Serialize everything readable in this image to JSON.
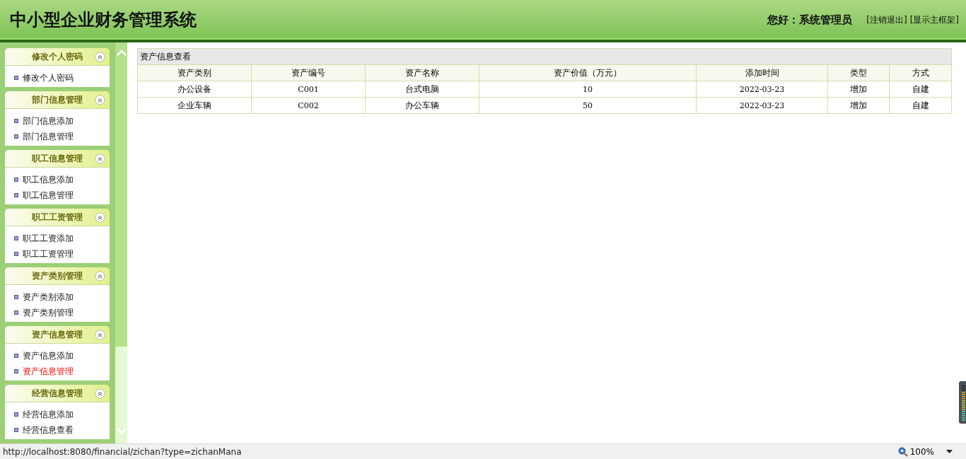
{
  "header": {
    "title": "中小型企业财务管理系统",
    "greeting": "您好：系统管理员",
    "links": [
      "[注销退出]",
      "[显示主框架]"
    ]
  },
  "sidebar": {
    "panels": [
      {
        "title": "修改个人密码",
        "items": [
          {
            "label": "修改个人密码",
            "selected": false
          }
        ]
      },
      {
        "title": "部门信息管理",
        "items": [
          {
            "label": "部门信息添加",
            "selected": false
          },
          {
            "label": "部门信息管理",
            "selected": false
          }
        ]
      },
      {
        "title": "职工信息管理",
        "items": [
          {
            "label": "职工信息添加",
            "selected": false
          },
          {
            "label": "职工信息管理",
            "selected": false
          }
        ]
      },
      {
        "title": "职工工资管理",
        "items": [
          {
            "label": "职工工资添加",
            "selected": false
          },
          {
            "label": "职工工资管理",
            "selected": false
          }
        ]
      },
      {
        "title": "资产类别管理",
        "items": [
          {
            "label": "资产类别添加",
            "selected": false
          },
          {
            "label": "资产类别管理",
            "selected": false
          }
        ]
      },
      {
        "title": "资产信息管理",
        "items": [
          {
            "label": "资产信息添加",
            "selected": false
          },
          {
            "label": "资产信息管理",
            "selected": true
          }
        ]
      },
      {
        "title": "经营信息管理",
        "items": [
          {
            "label": "经营信息添加",
            "selected": false
          },
          {
            "label": "经营信息查看",
            "selected": false
          }
        ]
      }
    ]
  },
  "table": {
    "title": "资产信息查看",
    "columns": [
      "资产类别",
      "资产编号",
      "资产名称",
      "资产价值（万元）",
      "添加时间",
      "类型",
      "方式"
    ],
    "rows": [
      [
        "办公设备",
        "C001",
        "台式电脑",
        "10",
        "2022-03-23",
        "增加",
        "自建"
      ],
      [
        "企业车辆",
        "C002",
        "办公车辆",
        "50",
        "2022-03-23",
        "增加",
        "自建"
      ]
    ]
  },
  "status_bar": {
    "url": "http://localhost:8080/financial/zichan?type=zichanMana",
    "zoom": "100%"
  }
}
